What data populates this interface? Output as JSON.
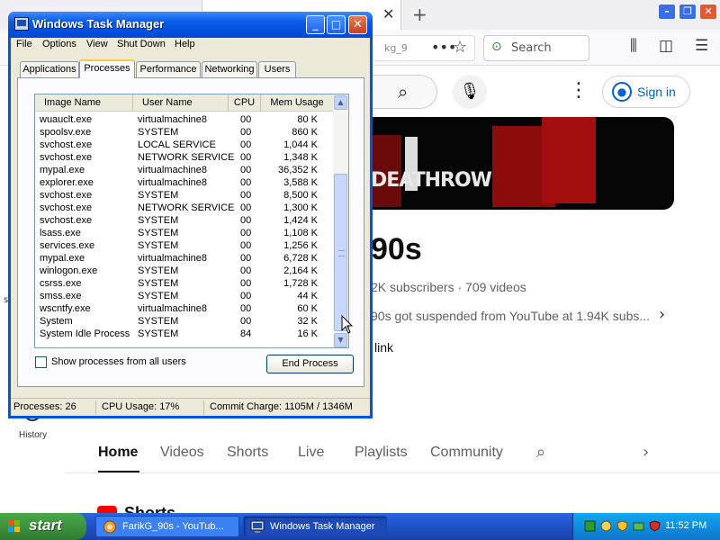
{
  "browser": {
    "url_partial": "kg_9",
    "search_placeholder": "Search",
    "yt_signin": "Sign in",
    "banner_text": "DEATHROW",
    "channel_name": "90s",
    "channel_meta": "2K subscribers · 709 videos",
    "channel_desc": "90s got suspended from YouTube at 1.94K subs...",
    "channel_link": "link",
    "sidebar_history": "History",
    "sidebar_s": "s",
    "tabs": [
      "Home",
      "Videos",
      "Shorts",
      "Live",
      "Playlists",
      "Community"
    ],
    "shorts_header": "Shorts"
  },
  "taskmgr": {
    "title": "Windows Task Manager",
    "menu": [
      "File",
      "Options",
      "View",
      "Shut Down",
      "Help"
    ],
    "tabs": [
      "Applications",
      "Processes",
      "Performance",
      "Networking",
      "Users"
    ],
    "active_tab": "Processes",
    "columns": [
      "Image Name",
      "User Name",
      "CPU",
      "Mem Usage"
    ],
    "processes": [
      {
        "name": "wuauclt.exe",
        "user": "virtualmachine8",
        "cpu": "00",
        "mem": "80 K"
      },
      {
        "name": "spoolsv.exe",
        "user": "SYSTEM",
        "cpu": "00",
        "mem": "860 K"
      },
      {
        "name": "svchost.exe",
        "user": "LOCAL SERVICE",
        "cpu": "00",
        "mem": "1,044 K"
      },
      {
        "name": "svchost.exe",
        "user": "NETWORK SERVICE",
        "cpu": "00",
        "mem": "1,348 K"
      },
      {
        "name": "mypal.exe",
        "user": "virtualmachine8",
        "cpu": "00",
        "mem": "36,352 K"
      },
      {
        "name": "explorer.exe",
        "user": "virtualmachine8",
        "cpu": "00",
        "mem": "3,588 K"
      },
      {
        "name": "svchost.exe",
        "user": "SYSTEM",
        "cpu": "00",
        "mem": "8,500 K"
      },
      {
        "name": "svchost.exe",
        "user": "NETWORK SERVICE",
        "cpu": "00",
        "mem": "1,300 K"
      },
      {
        "name": "svchost.exe",
        "user": "SYSTEM",
        "cpu": "00",
        "mem": "1,424 K"
      },
      {
        "name": "lsass.exe",
        "user": "SYSTEM",
        "cpu": "00",
        "mem": "1,108 K"
      },
      {
        "name": "services.exe",
        "user": "SYSTEM",
        "cpu": "00",
        "mem": "1,256 K"
      },
      {
        "name": "mypal.exe",
        "user": "virtualmachine8",
        "cpu": "00",
        "mem": "6,728 K"
      },
      {
        "name": "winlogon.exe",
        "user": "SYSTEM",
        "cpu": "00",
        "mem": "2,164 K"
      },
      {
        "name": "csrss.exe",
        "user": "SYSTEM",
        "cpu": "00",
        "mem": "1,728 K"
      },
      {
        "name": "smss.exe",
        "user": "SYSTEM",
        "cpu": "00",
        "mem": "44 K"
      },
      {
        "name": "wscntfy.exe",
        "user": "virtualmachine8",
        "cpu": "00",
        "mem": "60 K"
      },
      {
        "name": "System",
        "user": "SYSTEM",
        "cpu": "00",
        "mem": "32 K"
      },
      {
        "name": "System Idle Process",
        "user": "SYSTEM",
        "cpu": "84",
        "mem": "16 K"
      }
    ],
    "show_all_label": "Show processes from all users",
    "end_process_label": "End Process",
    "status": {
      "processes": "Processes: 26",
      "cpu": "CPU Usage: 17%",
      "commit": "Commit Charge: 1105M / 1346M"
    }
  },
  "taskbar": {
    "start_label": "start",
    "items": [
      {
        "label": "FarikG_90s - YouTub..."
      },
      {
        "label": "Windows Task Manager"
      }
    ],
    "clock": "11:52 PM"
  },
  "colors": {
    "xp_blue": "#0054e3",
    "xp_face": "#ece9d8",
    "start_green": "#3c8e3c",
    "yt_link_blue": "#065fd4"
  }
}
